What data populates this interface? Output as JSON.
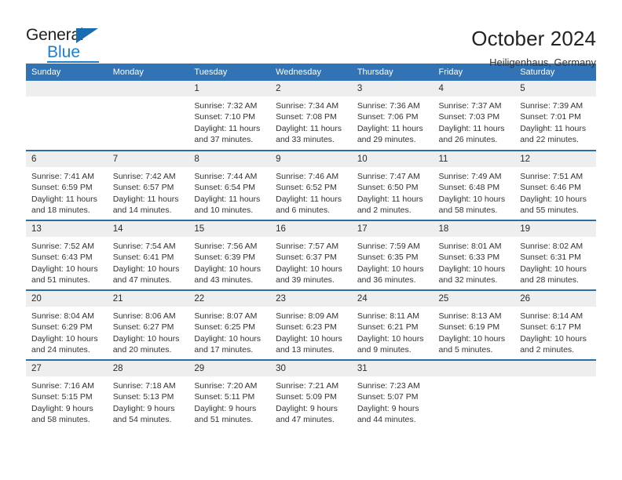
{
  "logo": {
    "line1": "General",
    "line2": "Blue",
    "triangle_icon": "triangle-icon"
  },
  "header": {
    "title": "October 2024",
    "subtitle": "Heiligenhaus, Germany"
  },
  "colors": {
    "header_blue": "#3173b4",
    "row_divider_blue": "#2e6da4",
    "daynum_band": "#eeeeee",
    "logo_blue": "#1a7fd4",
    "text": "#333333"
  },
  "calendar": {
    "weekday_headers": [
      "Sunday",
      "Monday",
      "Tuesday",
      "Wednesday",
      "Thursday",
      "Friday",
      "Saturday"
    ],
    "labels": {
      "sunrise": "Sunrise:",
      "sunset": "Sunset:",
      "daylight": "Daylight:"
    },
    "weeks": [
      [
        {
          "day": "",
          "sunrise": "",
          "sunset": "",
          "daylight_1": "",
          "daylight_2": ""
        },
        {
          "day": "",
          "sunrise": "",
          "sunset": "",
          "daylight_1": "",
          "daylight_2": ""
        },
        {
          "day": "1",
          "sunrise": "Sunrise: 7:32 AM",
          "sunset": "Sunset: 7:10 PM",
          "daylight_1": "Daylight: 11 hours",
          "daylight_2": "and 37 minutes."
        },
        {
          "day": "2",
          "sunrise": "Sunrise: 7:34 AM",
          "sunset": "Sunset: 7:08 PM",
          "daylight_1": "Daylight: 11 hours",
          "daylight_2": "and 33 minutes."
        },
        {
          "day": "3",
          "sunrise": "Sunrise: 7:36 AM",
          "sunset": "Sunset: 7:06 PM",
          "daylight_1": "Daylight: 11 hours",
          "daylight_2": "and 29 minutes."
        },
        {
          "day": "4",
          "sunrise": "Sunrise: 7:37 AM",
          "sunset": "Sunset: 7:03 PM",
          "daylight_1": "Daylight: 11 hours",
          "daylight_2": "and 26 minutes."
        },
        {
          "day": "5",
          "sunrise": "Sunrise: 7:39 AM",
          "sunset": "Sunset: 7:01 PM",
          "daylight_1": "Daylight: 11 hours",
          "daylight_2": "and 22 minutes."
        }
      ],
      [
        {
          "day": "6",
          "sunrise": "Sunrise: 7:41 AM",
          "sunset": "Sunset: 6:59 PM",
          "daylight_1": "Daylight: 11 hours",
          "daylight_2": "and 18 minutes."
        },
        {
          "day": "7",
          "sunrise": "Sunrise: 7:42 AM",
          "sunset": "Sunset: 6:57 PM",
          "daylight_1": "Daylight: 11 hours",
          "daylight_2": "and 14 minutes."
        },
        {
          "day": "8",
          "sunrise": "Sunrise: 7:44 AM",
          "sunset": "Sunset: 6:54 PM",
          "daylight_1": "Daylight: 11 hours",
          "daylight_2": "and 10 minutes."
        },
        {
          "day": "9",
          "sunrise": "Sunrise: 7:46 AM",
          "sunset": "Sunset: 6:52 PM",
          "daylight_1": "Daylight: 11 hours",
          "daylight_2": "and 6 minutes."
        },
        {
          "day": "10",
          "sunrise": "Sunrise: 7:47 AM",
          "sunset": "Sunset: 6:50 PM",
          "daylight_1": "Daylight: 11 hours",
          "daylight_2": "and 2 minutes."
        },
        {
          "day": "11",
          "sunrise": "Sunrise: 7:49 AM",
          "sunset": "Sunset: 6:48 PM",
          "daylight_1": "Daylight: 10 hours",
          "daylight_2": "and 58 minutes."
        },
        {
          "day": "12",
          "sunrise": "Sunrise: 7:51 AM",
          "sunset": "Sunset: 6:46 PM",
          "daylight_1": "Daylight: 10 hours",
          "daylight_2": "and 55 minutes."
        }
      ],
      [
        {
          "day": "13",
          "sunrise": "Sunrise: 7:52 AM",
          "sunset": "Sunset: 6:43 PM",
          "daylight_1": "Daylight: 10 hours",
          "daylight_2": "and 51 minutes."
        },
        {
          "day": "14",
          "sunrise": "Sunrise: 7:54 AM",
          "sunset": "Sunset: 6:41 PM",
          "daylight_1": "Daylight: 10 hours",
          "daylight_2": "and 47 minutes."
        },
        {
          "day": "15",
          "sunrise": "Sunrise: 7:56 AM",
          "sunset": "Sunset: 6:39 PM",
          "daylight_1": "Daylight: 10 hours",
          "daylight_2": "and 43 minutes."
        },
        {
          "day": "16",
          "sunrise": "Sunrise: 7:57 AM",
          "sunset": "Sunset: 6:37 PM",
          "daylight_1": "Daylight: 10 hours",
          "daylight_2": "and 39 minutes."
        },
        {
          "day": "17",
          "sunrise": "Sunrise: 7:59 AM",
          "sunset": "Sunset: 6:35 PM",
          "daylight_1": "Daylight: 10 hours",
          "daylight_2": "and 36 minutes."
        },
        {
          "day": "18",
          "sunrise": "Sunrise: 8:01 AM",
          "sunset": "Sunset: 6:33 PM",
          "daylight_1": "Daylight: 10 hours",
          "daylight_2": "and 32 minutes."
        },
        {
          "day": "19",
          "sunrise": "Sunrise: 8:02 AM",
          "sunset": "Sunset: 6:31 PM",
          "daylight_1": "Daylight: 10 hours",
          "daylight_2": "and 28 minutes."
        }
      ],
      [
        {
          "day": "20",
          "sunrise": "Sunrise: 8:04 AM",
          "sunset": "Sunset: 6:29 PM",
          "daylight_1": "Daylight: 10 hours",
          "daylight_2": "and 24 minutes."
        },
        {
          "day": "21",
          "sunrise": "Sunrise: 8:06 AM",
          "sunset": "Sunset: 6:27 PM",
          "daylight_1": "Daylight: 10 hours",
          "daylight_2": "and 20 minutes."
        },
        {
          "day": "22",
          "sunrise": "Sunrise: 8:07 AM",
          "sunset": "Sunset: 6:25 PM",
          "daylight_1": "Daylight: 10 hours",
          "daylight_2": "and 17 minutes."
        },
        {
          "day": "23",
          "sunrise": "Sunrise: 8:09 AM",
          "sunset": "Sunset: 6:23 PM",
          "daylight_1": "Daylight: 10 hours",
          "daylight_2": "and 13 minutes."
        },
        {
          "day": "24",
          "sunrise": "Sunrise: 8:11 AM",
          "sunset": "Sunset: 6:21 PM",
          "daylight_1": "Daylight: 10 hours",
          "daylight_2": "and 9 minutes."
        },
        {
          "day": "25",
          "sunrise": "Sunrise: 8:13 AM",
          "sunset": "Sunset: 6:19 PM",
          "daylight_1": "Daylight: 10 hours",
          "daylight_2": "and 5 minutes."
        },
        {
          "day": "26",
          "sunrise": "Sunrise: 8:14 AM",
          "sunset": "Sunset: 6:17 PM",
          "daylight_1": "Daylight: 10 hours",
          "daylight_2": "and 2 minutes."
        }
      ],
      [
        {
          "day": "27",
          "sunrise": "Sunrise: 7:16 AM",
          "sunset": "Sunset: 5:15 PM",
          "daylight_1": "Daylight: 9 hours",
          "daylight_2": "and 58 minutes."
        },
        {
          "day": "28",
          "sunrise": "Sunrise: 7:18 AM",
          "sunset": "Sunset: 5:13 PM",
          "daylight_1": "Daylight: 9 hours",
          "daylight_2": "and 54 minutes."
        },
        {
          "day": "29",
          "sunrise": "Sunrise: 7:20 AM",
          "sunset": "Sunset: 5:11 PM",
          "daylight_1": "Daylight: 9 hours",
          "daylight_2": "and 51 minutes."
        },
        {
          "day": "30",
          "sunrise": "Sunrise: 7:21 AM",
          "sunset": "Sunset: 5:09 PM",
          "daylight_1": "Daylight: 9 hours",
          "daylight_2": "and 47 minutes."
        },
        {
          "day": "31",
          "sunrise": "Sunrise: 7:23 AM",
          "sunset": "Sunset: 5:07 PM",
          "daylight_1": "Daylight: 9 hours",
          "daylight_2": "and 44 minutes."
        },
        {
          "day": "",
          "sunrise": "",
          "sunset": "",
          "daylight_1": "",
          "daylight_2": ""
        },
        {
          "day": "",
          "sunrise": "",
          "sunset": "",
          "daylight_1": "",
          "daylight_2": ""
        }
      ]
    ]
  }
}
